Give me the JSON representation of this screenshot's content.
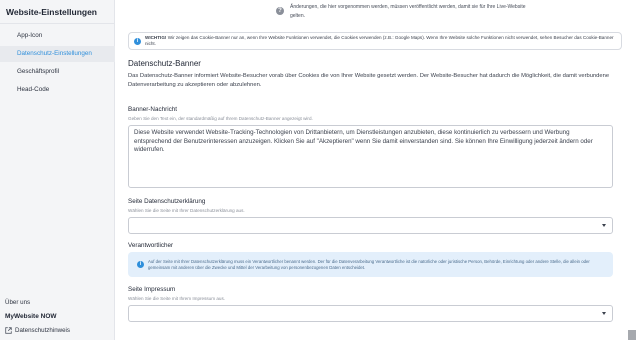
{
  "sidebar": {
    "title": "Website-Einstellungen",
    "items": [
      {
        "label": "App-Icon",
        "active": false
      },
      {
        "label": "Datenschutz-Einstellungen",
        "active": true
      },
      {
        "label": "Geschäftsprofil",
        "active": false
      },
      {
        "label": "Head-Code",
        "active": false
      }
    ],
    "about_label": "Über uns",
    "product_name": "MyWebsite NOW",
    "privacy_link": "Datenschutzhinweis"
  },
  "top_notice": {
    "text": "Änderungen, die hier vorgenommen werden, müssen veröffentlicht werden, damit sie für Ihre Live-Website gelten."
  },
  "info_banner": {
    "strong": "WICHTIG!",
    "text": " Wir zeigen das Cookie-Banner nur an, wenn Ihre Website Funktionen verwendet, die Cookies verwenden (z.B.: Google Maps). Wenn Ihre Website solche Funktionen nicht verwendet, sehen Besucher das Cookie-Banner nicht."
  },
  "section": {
    "title": "Datenschutz-Banner",
    "description": "Das Datenschutz-Banner informiert Website-Besucher vorab über Cookies die von Ihrer Website gesetzt werden. Der Website-Besucher hat dadurch die Möglichkeit, die damit verbundene Datenverarbeitung zu akzeptieren oder abzulehnen."
  },
  "banner_message": {
    "label": "Banner-Nachricht",
    "help": "Geben Sie den Text ein, der standardmäßig auf Ihrem Datenschutz-Banner angezeigt wird.",
    "value": "Diese Website verwendet Website-Tracking-Technologien von Drittanbietern, um Dienstleistungen anzubieten, diese kontinuierlich zu verbessern und Werbung entsprechend der Benutzerinteressen anzuzeigen. Klicken Sie auf \"Akzeptieren\" wenn Sie damit einverstanden sind. Sie können Ihre Einwilligung jederzeit ändern oder widerrufen."
  },
  "privacy_page": {
    "label": "Seite Datenschutzerklärung",
    "help": "Wählen Sie die Seite mit Ihrer Datenschutzerklärung aus.",
    "value": ""
  },
  "responsible": {
    "label": "Verantwortlicher",
    "info": "Auf der Seite mit Ihrer Datenschutzerklärung muss ein Verantwortlicher benannt werden. Der für die Datenverarbeitung Verantwortliche ist die natürliche oder juristische Person, Behörde, Einrichtung oder andere Stelle, die allein oder gemeinsam mit anderen über die Zwecke und Mittel der Verarbeitung von personenbezogenen Daten entscheidet."
  },
  "imprint_page": {
    "label": "Seite Impressum",
    "help": "Wählen Sie die Seite mit Ihrem Impressum aus.",
    "value": ""
  },
  "colors": {
    "accent": "#2f8fdb",
    "sidebar_bg": "#f4f5f7",
    "info_bg": "#e3effb"
  }
}
